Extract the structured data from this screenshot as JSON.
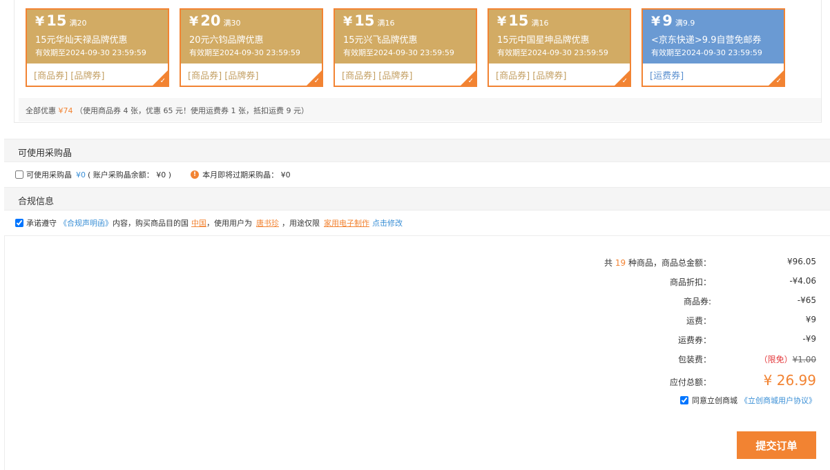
{
  "coupons": [
    {
      "yen": "¥",
      "amount": "15",
      "condition": "满20",
      "title": "15元华灿天禄品牌优惠",
      "expire": "有效期至2024-09-30 23:59:59",
      "tags": "[商品券] [品牌券]",
      "theme": "gold"
    },
    {
      "yen": "¥",
      "amount": "20",
      "condition": "满30",
      "title": "20元六钧品牌优惠",
      "expire": "有效期至2024-09-30 23:59:59",
      "tags": "[商品券] [品牌券]",
      "theme": "gold"
    },
    {
      "yen": "¥",
      "amount": "15",
      "condition": "满16",
      "title": "15元兴飞品牌优惠",
      "expire": "有效期至2024-09-30 23:59:59",
      "tags": "[商品券] [品牌券]",
      "theme": "gold"
    },
    {
      "yen": "¥",
      "amount": "15",
      "condition": "满16",
      "title": "15元中国星坤品牌优惠",
      "expire": "有效期至2024-09-30 23:59:59",
      "tags": "[商品券] [品牌券]",
      "theme": "gold"
    },
    {
      "yen": "¥",
      "amount": "9",
      "condition": "满9.9",
      "title": "<京东快递>9.9自营免邮券",
      "expire": "有效期至2024-09-30 23:59:59",
      "tags": "[运费券]",
      "theme": "blue"
    }
  ],
  "summary": {
    "label": "全部优惠",
    "amount": "¥74",
    "detail": "（使用商品券 4 张，优惠 65 元！使用运费券 1 张，抵扣运费 9 元）"
  },
  "purchase_crystal": {
    "section_title": "可使用采购晶",
    "checkbox_label": "可使用采购晶",
    "value": "¥0",
    "balance_text": "( 账户采购晶余额： ¥0 )",
    "info_icon": "info-icon",
    "expiring_text": "本月即将过期采购晶： ¥0"
  },
  "compliance": {
    "section_title": "合规信息",
    "prefix": "承诺遵守",
    "statement_link": "《合规声明函》",
    "mid1": "内容，购买商品目的国",
    "country": "中国",
    "mid2": "，使用用户为",
    "user": "唐书珍",
    "mid3": "，用途仅限",
    "usage": "家用电子制作",
    "edit_link": "点击修改"
  },
  "totals": {
    "count_prefix": "共",
    "count": "19",
    "count_suffix": "种商品，商品总金额：",
    "goods_total": "¥96.05",
    "discount_label": "商品折扣：",
    "discount_value": "-¥4.06",
    "coupon_label": "商品券:",
    "coupon_value": "-¥65",
    "shipping_label": "运费：",
    "shipping_value": "¥9",
    "shipping_coupon_label": "运费券：",
    "shipping_coupon_value": "-¥9",
    "packing_label": "包装费：",
    "packing_free": "（限免）",
    "packing_value": "¥1.00",
    "payable_label": "应付总额：",
    "payable_value": "¥ 26.99"
  },
  "agreement": {
    "prefix": "同意立创商城",
    "link": "《立创商城用户协议》"
  },
  "submit_label": "提交订单",
  "colors": {
    "accent": "#f28332",
    "coupon_gold": "#d2ab64",
    "coupon_blue": "#6a9ad3",
    "link_blue": "#3a8fd6"
  }
}
